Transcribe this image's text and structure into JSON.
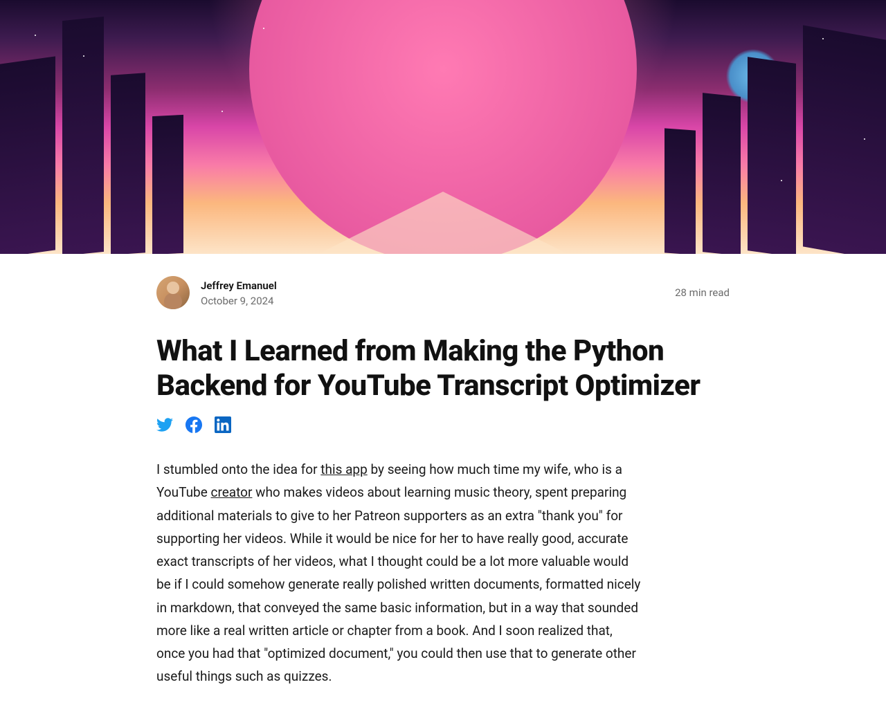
{
  "author": {
    "name": "Jeffrey Emanuel",
    "date": "October 9, 2024"
  },
  "read_time": "28 min read",
  "title": "What I Learned from Making the Python Backend for YouTube Transcript Optimizer",
  "social": {
    "twitter": "twitter",
    "facebook": "facebook",
    "linkedin": "linkedin"
  },
  "body": {
    "p1_part1": "I stumbled onto the idea for ",
    "p1_link1": "this app",
    "p1_part2": " by seeing how much time my wife, who is a YouTube ",
    "p1_link2": "creator",
    "p1_part3": " who makes videos about learning music theory, spent preparing additional materials to give to her Patreon supporters as an extra \"thank you\" for supporting her videos. While it would be nice for her to have really good, accurate exact transcripts of her videos, what I thought could be a lot more valuable would be if I could somehow generate really polished written documents, formatted nicely in markdown, that conveyed the same basic information, but in a way that sounded more like a real written article or chapter from a book. And I soon realized that, once you had that \"optimized document,\" you could then use that to generate other useful things such as quizzes."
  }
}
